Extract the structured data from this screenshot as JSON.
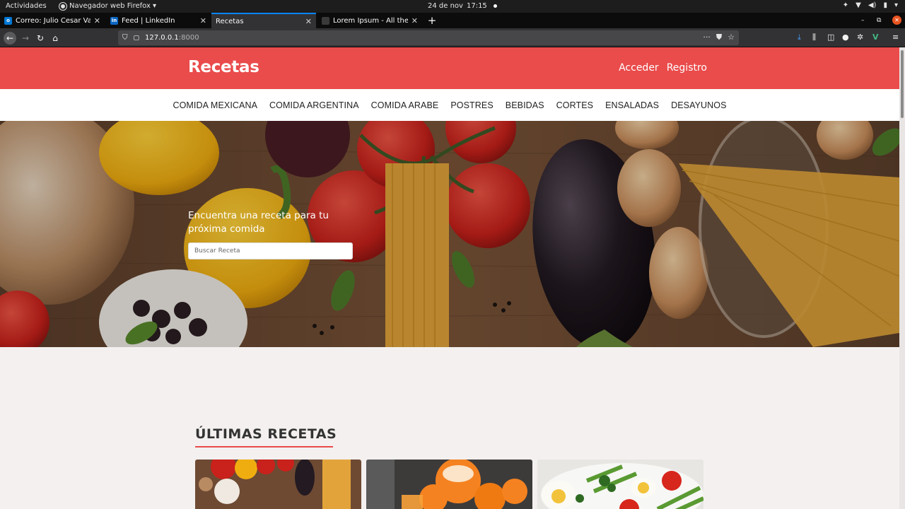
{
  "system": {
    "activities": "Actividades",
    "app_name": "Navegador web Firefox ▾",
    "date": "24 de nov",
    "time": "17:15"
  },
  "tabs": [
    {
      "title": "Correo: Julio Cesar Valad",
      "favicon": "outlook-icon",
      "active": false
    },
    {
      "title": "Feed | LinkedIn",
      "favicon": "linkedin-icon",
      "active": false
    },
    {
      "title": "Recetas",
      "favicon": "",
      "active": true
    },
    {
      "title": "Lorem Ipsum - All the fac",
      "favicon": "lorem-icon",
      "active": false
    }
  ],
  "urlbar": {
    "host": "127.0.0.1",
    "port": ":8000"
  },
  "site": {
    "brand": "Recetas",
    "login": "Acceder",
    "register": "Registro",
    "categories": [
      "COMIDA MEXICANA",
      "COMIDA ARGENTINA",
      "COMIDA ARABE",
      "POSTRES",
      "BEBIDAS",
      "CORTES",
      "ENSALADAS",
      "DESAYUNOS"
    ],
    "hero_text": "Encuentra una receta para tu próxima comida",
    "search_placeholder": "Buscar Receta",
    "latest_heading": "ÚLTIMAS RECETAS"
  },
  "colors": {
    "brand_red": "#ea4b4b",
    "firefox_blue": "#0a84ff",
    "ubuntu_orange": "#e95420"
  }
}
